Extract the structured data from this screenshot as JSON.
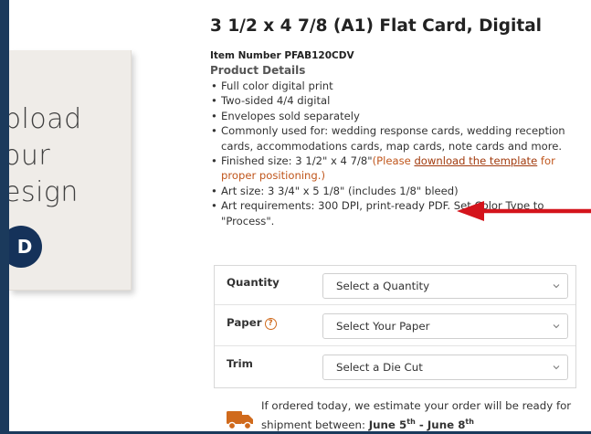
{
  "preview": {
    "lines": [
      "pload",
      "our",
      "esign"
    ],
    "button_label": "D"
  },
  "product": {
    "title": "3 1/2 x 4 7/8 (A1) Flat Card, Digital",
    "item_number_label": "Item Number",
    "item_number": "PFAB120CDV",
    "details_heading": "Product Details",
    "details": [
      "Full color digital print",
      "Two-sided 4/4 digital",
      "Envelopes sold separately",
      "Commonly used for: wedding response cards, wedding reception cards, accommodations cards, map cards, note cards and more.",
      "Finished size: 3 1/2\" x 4 7/8\"",
      "Art size: 3 3/4\" x 5 1/8\" (includes 1/8\" bleed)",
      "Art requirements: 300 DPI, print-ready PDF. Set Color Type to \"Process\"."
    ],
    "finished_note_prefix": "(Please ",
    "finished_note_link": "download the template",
    "finished_note_suffix": " for proper positioning.)"
  },
  "options": {
    "quantity_label": "Quantity",
    "quantity_value": "Select a Quantity",
    "paper_label": "Paper",
    "paper_help": "?",
    "paper_value": "Select Your Paper",
    "trim_label": "Trim",
    "trim_value": "Select a Die Cut"
  },
  "shipping": {
    "line1": "If ordered today, we estimate your order will be ready for",
    "line2_prefix": "shipment between: ",
    "start_day": "June 5",
    "start_sup": "th",
    "separator": " - ",
    "end_day": "June 8",
    "end_sup": "th"
  },
  "colors": {
    "accent_arrow": "#d4141c",
    "link": "#a23b0e",
    "note": "#c0561c",
    "frame": "#1b3a5c",
    "button": "#15325a"
  },
  "icons": {
    "arrow": "red-arrow-icon",
    "help": "help-circle-icon",
    "chevron": "chevron-down-icon",
    "truck": "truck-icon"
  }
}
